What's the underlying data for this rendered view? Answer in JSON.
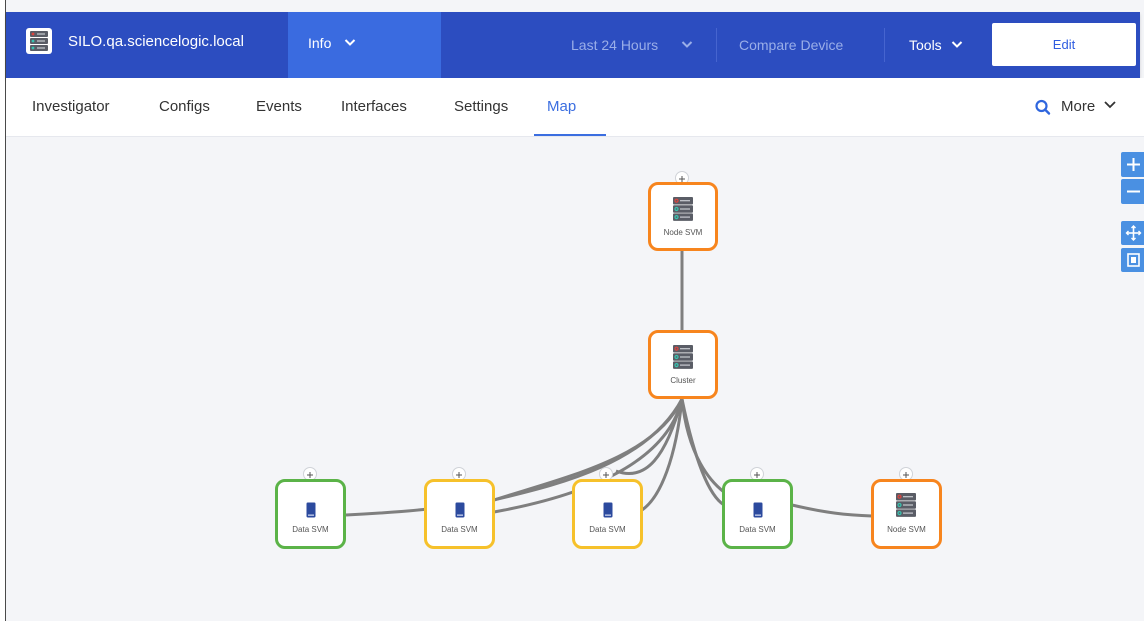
{
  "header": {
    "device_name": "SILO.qa.sciencelogic.local",
    "info_label": "Info",
    "time_range_label": "Last 24 Hours",
    "compare_label": "Compare Device",
    "tools_label": "Tools",
    "edit_label": "Edit",
    "device_icon": "server-stack-icon"
  },
  "tabs": [
    {
      "label": "Investigator",
      "active": false
    },
    {
      "label": "Configs",
      "active": false
    },
    {
      "label": "Events",
      "active": false
    },
    {
      "label": "Interfaces",
      "active": false
    },
    {
      "label": "Settings",
      "active": false
    },
    {
      "label": "Map",
      "active": true
    }
  ],
  "more_label": "More",
  "map_controls": [
    "zoom-in-icon",
    "zoom-out-icon",
    "pan-icon",
    "fit-icon"
  ],
  "nodes": {
    "top": {
      "label": "Node SVM",
      "status": "orange",
      "icon": "server-stack-icon"
    },
    "cluster": {
      "label": "Cluster",
      "status": "orange",
      "icon": "server-stack-icon"
    },
    "data1": {
      "label": "Data SVM",
      "status": "green",
      "icon": "phone-device-icon"
    },
    "data2": {
      "label": "Data SVM",
      "status": "yellow",
      "icon": "phone-device-icon"
    },
    "data3": {
      "label": "Data SVM",
      "status": "yellow",
      "icon": "phone-device-icon"
    },
    "data4": {
      "label": "Data SVM",
      "status": "green",
      "icon": "phone-device-icon"
    },
    "bottom_right": {
      "label": "Node SVM",
      "status": "orange",
      "icon": "server-stack-icon"
    }
  },
  "colors": {
    "header_bg": "#2c4dc0",
    "info_tab_bg": "#3a6be0",
    "accent": "#3b6ee0",
    "status_orange": "#f7851e",
    "status_green": "#5bb348",
    "status_yellow": "#f6c12b",
    "edge": "#7f7f7f"
  }
}
